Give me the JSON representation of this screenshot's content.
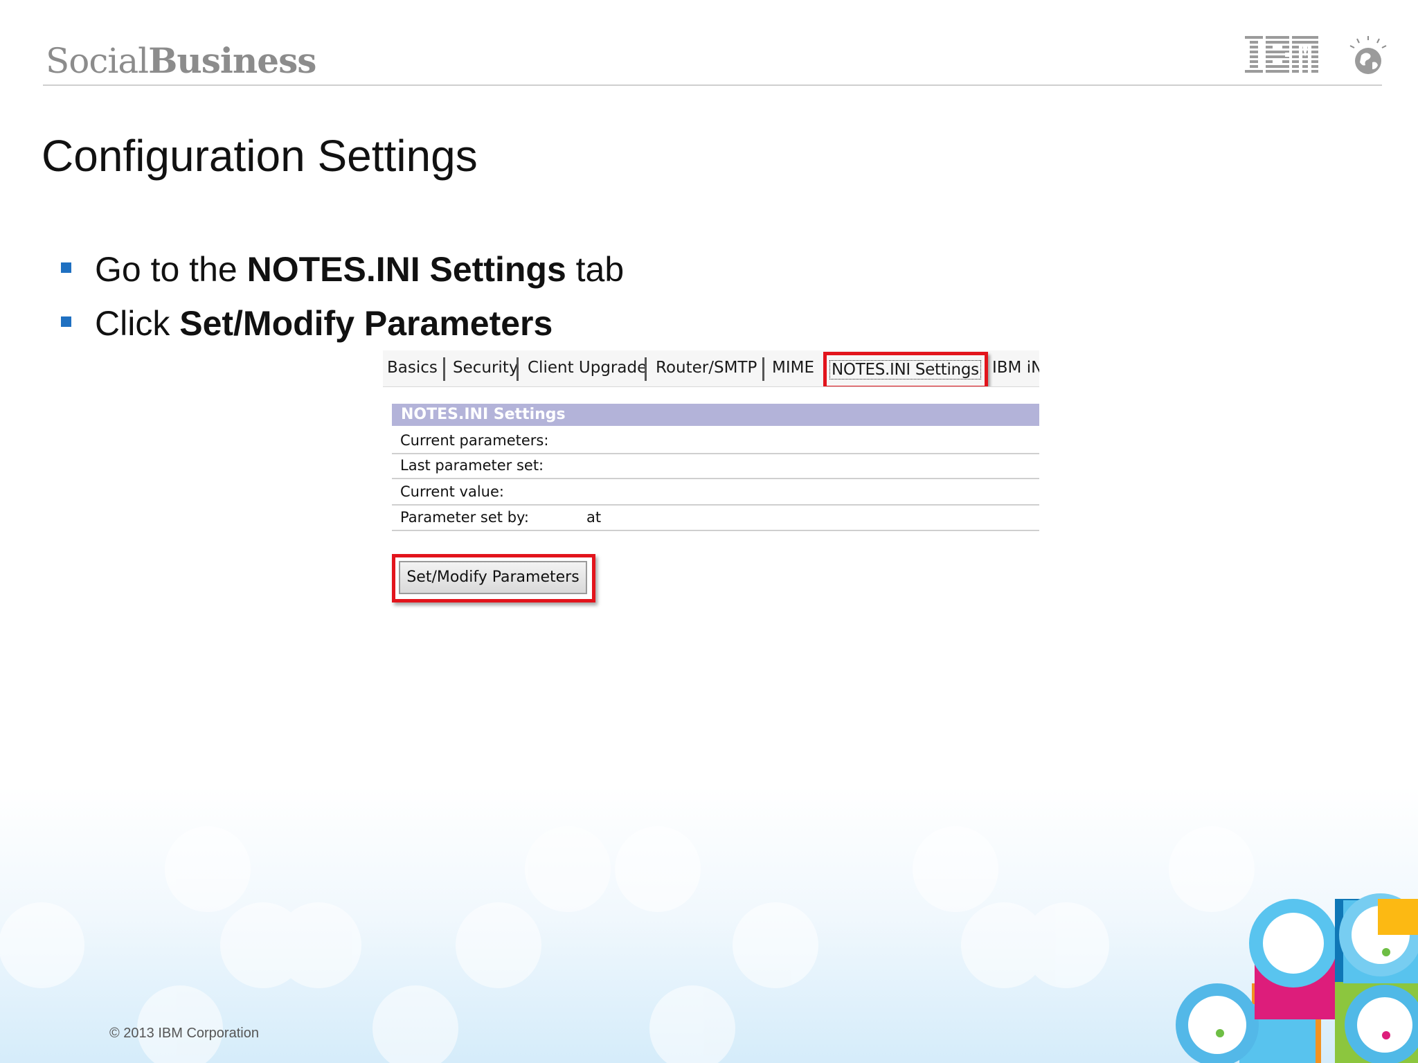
{
  "header": {
    "brand_part1": "Social",
    "brand_part2": "Business",
    "logo_text": "IBM"
  },
  "slide": {
    "title": "Configuration Settings",
    "bullets": [
      {
        "prefix": "Go to the ",
        "bold": "NOTES.INI Settings",
        "suffix": " tab"
      },
      {
        "prefix": "Click ",
        "bold": "Set/Modify Parameters",
        "suffix": ""
      }
    ]
  },
  "screenshot": {
    "tabs": [
      "Basics",
      "Security",
      "Client Upgrade",
      "Router/SMTP",
      "MIME",
      "NOTES.INI Settings",
      "IBM iN"
    ],
    "active_tab": "NOTES.INI Settings",
    "section_title": "NOTES.INI Settings",
    "fields": {
      "current_parameters": "Current parameters:",
      "last_parameter_set": "Last parameter set:",
      "current_value": "Current value:",
      "parameter_set_by": "Parameter set by:",
      "at": "at"
    },
    "button_label": "Set/Modify Parameters"
  },
  "footer": {
    "copyright": "© 2013 IBM Corporation"
  },
  "colors": {
    "bullet": "#1f70c1",
    "highlight": "#e2141c",
    "section_header": "#b3b3d9"
  }
}
